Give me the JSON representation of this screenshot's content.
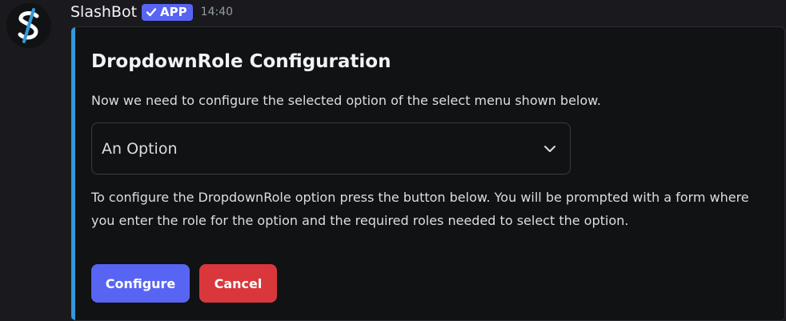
{
  "message": {
    "author": "SlashBot",
    "badge": {
      "label": "APP",
      "icon": "check-icon",
      "color": "#5865f2"
    },
    "timestamp": "14:40",
    "avatar": {
      "icon": "slashbot-logo",
      "accent": "#3498db"
    }
  },
  "embed": {
    "accent_color": "#3498db",
    "title": "DropdownRole Configuration",
    "description": "Now we need to configure the selected option of the select menu shown below.",
    "select_menu": {
      "selected": "An Option",
      "icon": "chevron-down-icon"
    },
    "body": "To configure the DropdownRole option press the button below. You will be prompted with a form where you enter the role for the option and the required roles needed to select the option."
  },
  "buttons": {
    "configure": {
      "label": "Configure",
      "color": "#5865f2"
    },
    "cancel": {
      "label": "Cancel",
      "color": "#da373c"
    }
  }
}
